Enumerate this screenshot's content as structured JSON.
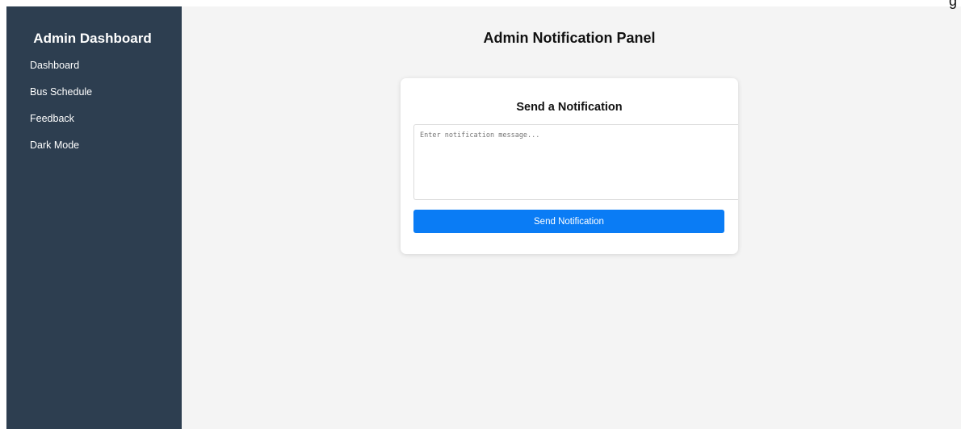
{
  "sidebar": {
    "title": "Admin Dashboard",
    "items": [
      {
        "label": "Dashboard"
      },
      {
        "label": "Bus Schedule"
      },
      {
        "label": "Feedback"
      },
      {
        "label": "Dark Mode"
      }
    ]
  },
  "main": {
    "title": "Admin Notification Panel",
    "card": {
      "title": "Send a Notification",
      "message_placeholder": "Enter notification message...",
      "message_value": "",
      "send_label": "Send Notification"
    }
  },
  "corner_text": "g",
  "colors": {
    "sidebar_bg": "#2d3e50",
    "main_bg": "#f4f4f4",
    "button_bg": "#0a7cf5",
    "card_bg": "#ffffff"
  }
}
